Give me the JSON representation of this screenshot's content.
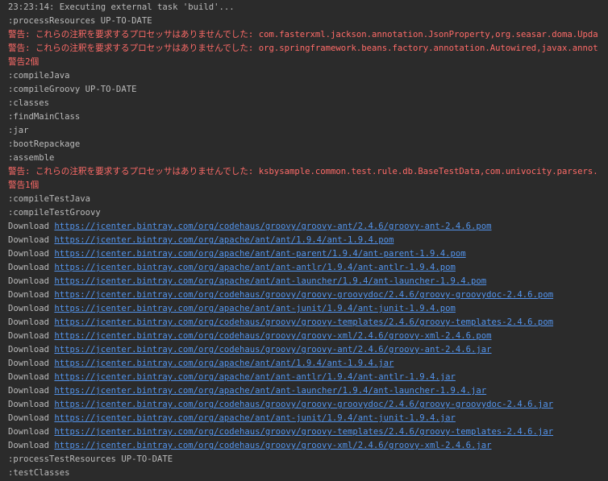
{
  "colors": {
    "background": "#2b2b2b",
    "text": "#bbbbbb",
    "warning": "#ff6b68",
    "link": "#5394ec"
  },
  "console": {
    "lines": [
      {
        "type": "text",
        "text": "23:23:14: Executing external task 'build'..."
      },
      {
        "type": "text",
        "text": ":processResources UP-TO-DATE"
      },
      {
        "type": "warn",
        "text": "警告: これらの注釈を要求するプロセッサはありませんでした: com.fasterxml.jackson.annotation.JsonProperty,org.seasar.doma.Upda"
      },
      {
        "type": "warn",
        "text": "警告: これらの注釈を要求するプロセッサはありませんでした: org.springframework.beans.factory.annotation.Autowired,javax.annot"
      },
      {
        "type": "warn",
        "text": "警告2個"
      },
      {
        "type": "text",
        "text": ":compileJava"
      },
      {
        "type": "text",
        "text": ":compileGroovy UP-TO-DATE"
      },
      {
        "type": "text",
        "text": ":classes"
      },
      {
        "type": "text",
        "text": ":findMainClass"
      },
      {
        "type": "text",
        "text": ":jar"
      },
      {
        "type": "text",
        "text": ":bootRepackage"
      },
      {
        "type": "text",
        "text": ":assemble"
      },
      {
        "type": "warn",
        "text": "警告: これらの注釈を要求するプロセッサはありませんでした: ksbysample.common.test.rule.db.BaseTestData,com.univocity.parsers."
      },
      {
        "type": "warn",
        "text": "警告1個"
      },
      {
        "type": "text",
        "text": ":compileTestJava"
      },
      {
        "type": "text",
        "text": ":compileTestGroovy"
      },
      {
        "type": "download",
        "prefix": "Download ",
        "link": "https://jcenter.bintray.com/org/codehaus/groovy/groovy-ant/2.4.6/groovy-ant-2.4.6.pom"
      },
      {
        "type": "download",
        "prefix": "Download ",
        "link": "https://jcenter.bintray.com/org/apache/ant/ant/1.9.4/ant-1.9.4.pom"
      },
      {
        "type": "download",
        "prefix": "Download ",
        "link": "https://jcenter.bintray.com/org/apache/ant/ant-parent/1.9.4/ant-parent-1.9.4.pom"
      },
      {
        "type": "download",
        "prefix": "Download ",
        "link": "https://jcenter.bintray.com/org/apache/ant/ant-antlr/1.9.4/ant-antlr-1.9.4.pom"
      },
      {
        "type": "download",
        "prefix": "Download ",
        "link": "https://jcenter.bintray.com/org/apache/ant/ant-launcher/1.9.4/ant-launcher-1.9.4.pom"
      },
      {
        "type": "download",
        "prefix": "Download ",
        "link": "https://jcenter.bintray.com/org/codehaus/groovy/groovy-groovydoc/2.4.6/groovy-groovydoc-2.4.6.pom"
      },
      {
        "type": "download",
        "prefix": "Download ",
        "link": "https://jcenter.bintray.com/org/apache/ant/ant-junit/1.9.4/ant-junit-1.9.4.pom"
      },
      {
        "type": "download",
        "prefix": "Download ",
        "link": "https://jcenter.bintray.com/org/codehaus/groovy/groovy-templates/2.4.6/groovy-templates-2.4.6.pom"
      },
      {
        "type": "download",
        "prefix": "Download ",
        "link": "https://jcenter.bintray.com/org/codehaus/groovy/groovy-xml/2.4.6/groovy-xml-2.4.6.pom"
      },
      {
        "type": "download",
        "prefix": "Download ",
        "link": "https://jcenter.bintray.com/org/codehaus/groovy/groovy-ant/2.4.6/groovy-ant-2.4.6.jar"
      },
      {
        "type": "download",
        "prefix": "Download ",
        "link": "https://jcenter.bintray.com/org/apache/ant/ant/1.9.4/ant-1.9.4.jar"
      },
      {
        "type": "download",
        "prefix": "Download ",
        "link": "https://jcenter.bintray.com/org/apache/ant/ant-antlr/1.9.4/ant-antlr-1.9.4.jar"
      },
      {
        "type": "download",
        "prefix": "Download ",
        "link": "https://jcenter.bintray.com/org/apache/ant/ant-launcher/1.9.4/ant-launcher-1.9.4.jar"
      },
      {
        "type": "download",
        "prefix": "Download ",
        "link": "https://jcenter.bintray.com/org/codehaus/groovy/groovy-groovydoc/2.4.6/groovy-groovydoc-2.4.6.jar"
      },
      {
        "type": "download",
        "prefix": "Download ",
        "link": "https://jcenter.bintray.com/org/apache/ant/ant-junit/1.9.4/ant-junit-1.9.4.jar"
      },
      {
        "type": "download",
        "prefix": "Download ",
        "link": "https://jcenter.bintray.com/org/codehaus/groovy/groovy-templates/2.4.6/groovy-templates-2.4.6.jar"
      },
      {
        "type": "download",
        "prefix": "Download ",
        "link": "https://jcenter.bintray.com/org/codehaus/groovy/groovy-xml/2.4.6/groovy-xml-2.4.6.jar"
      },
      {
        "type": "text",
        "text": ":processTestResources UP-TO-DATE"
      },
      {
        "type": "text",
        "text": ":testClasses"
      }
    ]
  }
}
